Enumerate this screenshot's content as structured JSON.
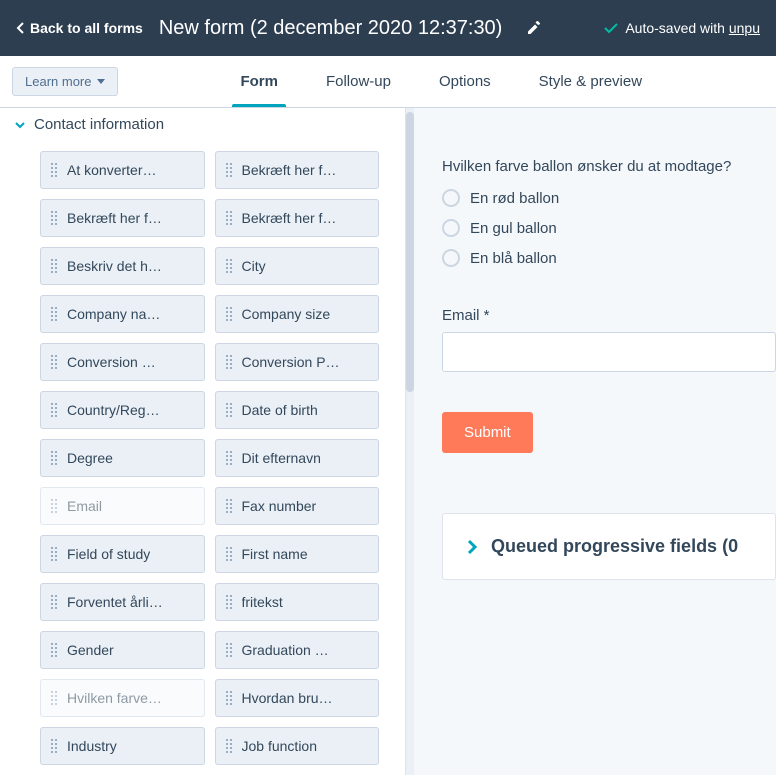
{
  "header": {
    "back_label": "Back to all forms",
    "title": "New form (2 december 2020 12:37:30)",
    "autosave_prefix": "Auto-saved with ",
    "autosave_link": "unpu"
  },
  "subheader": {
    "learn_more": "Learn more"
  },
  "tabs": {
    "form": "Form",
    "followup": "Follow-up",
    "options": "Options",
    "style": "Style & preview"
  },
  "section": {
    "contact_info": "Contact information"
  },
  "fields": [
    {
      "label": "At konverter…",
      "disabled": false
    },
    {
      "label": "Bekræft her f…",
      "disabled": false
    },
    {
      "label": "Bekræft her f…",
      "disabled": false
    },
    {
      "label": "Bekræft her f…",
      "disabled": false
    },
    {
      "label": "Beskriv det h…",
      "disabled": false
    },
    {
      "label": "City",
      "disabled": false
    },
    {
      "label": "Company na…",
      "disabled": false
    },
    {
      "label": "Company size",
      "disabled": false
    },
    {
      "label": "Conversion …",
      "disabled": false
    },
    {
      "label": "Conversion P…",
      "disabled": false
    },
    {
      "label": "Country/Reg…",
      "disabled": false
    },
    {
      "label": "Date of birth",
      "disabled": false
    },
    {
      "label": "Degree",
      "disabled": false
    },
    {
      "label": "Dit efternavn",
      "disabled": false
    },
    {
      "label": "Email",
      "disabled": true
    },
    {
      "label": "Fax number",
      "disabled": false
    },
    {
      "label": "Field of study",
      "disabled": false
    },
    {
      "label": "First name",
      "disabled": false
    },
    {
      "label": "Forventet årli…",
      "disabled": false
    },
    {
      "label": "fritekst",
      "disabled": false
    },
    {
      "label": "Gender",
      "disabled": false
    },
    {
      "label": "Graduation …",
      "disabled": false
    },
    {
      "label": "Hvilken farve…",
      "disabled": true
    },
    {
      "label": "Hvordan bru…",
      "disabled": false
    },
    {
      "label": "Industry",
      "disabled": false
    },
    {
      "label": "Job function",
      "disabled": false
    }
  ],
  "preview": {
    "question": "Hvilken farve ballon ønsker du at modtage?",
    "options": [
      "En rød ballon",
      "En gul ballon",
      "En blå ballon"
    ],
    "email_label": "Email *",
    "submit": "Submit"
  },
  "queued": {
    "title": "Queued progressive fields (0"
  }
}
